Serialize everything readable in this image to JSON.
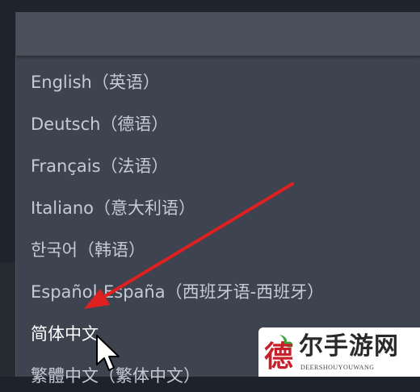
{
  "language_menu": {
    "items": [
      {
        "label": "English（英语）",
        "selected": false
      },
      {
        "label": "Deutsch（德语）",
        "selected": false
      },
      {
        "label": "Français（法语）",
        "selected": false
      },
      {
        "label": "Italiano（意大利语）",
        "selected": false
      },
      {
        "label": "한국어（韩语）",
        "selected": false
      },
      {
        "label": "Español-España（西班牙语-西班牙）",
        "selected": false
      },
      {
        "label": "简体中文",
        "selected": true
      },
      {
        "label": "繁體中文（繁体中文）",
        "selected": false
      }
    ]
  },
  "watermark": {
    "logo_char": "德",
    "title": "尔手游网",
    "subtitle": "DEERSHOUYOUWANG"
  },
  "colors": {
    "menu_background": "#3d4450",
    "menu_text": "#c4cbd6",
    "highlight_text": "#ffffff",
    "arrow": "#e02020",
    "watermark_logo": "#c8202a"
  }
}
